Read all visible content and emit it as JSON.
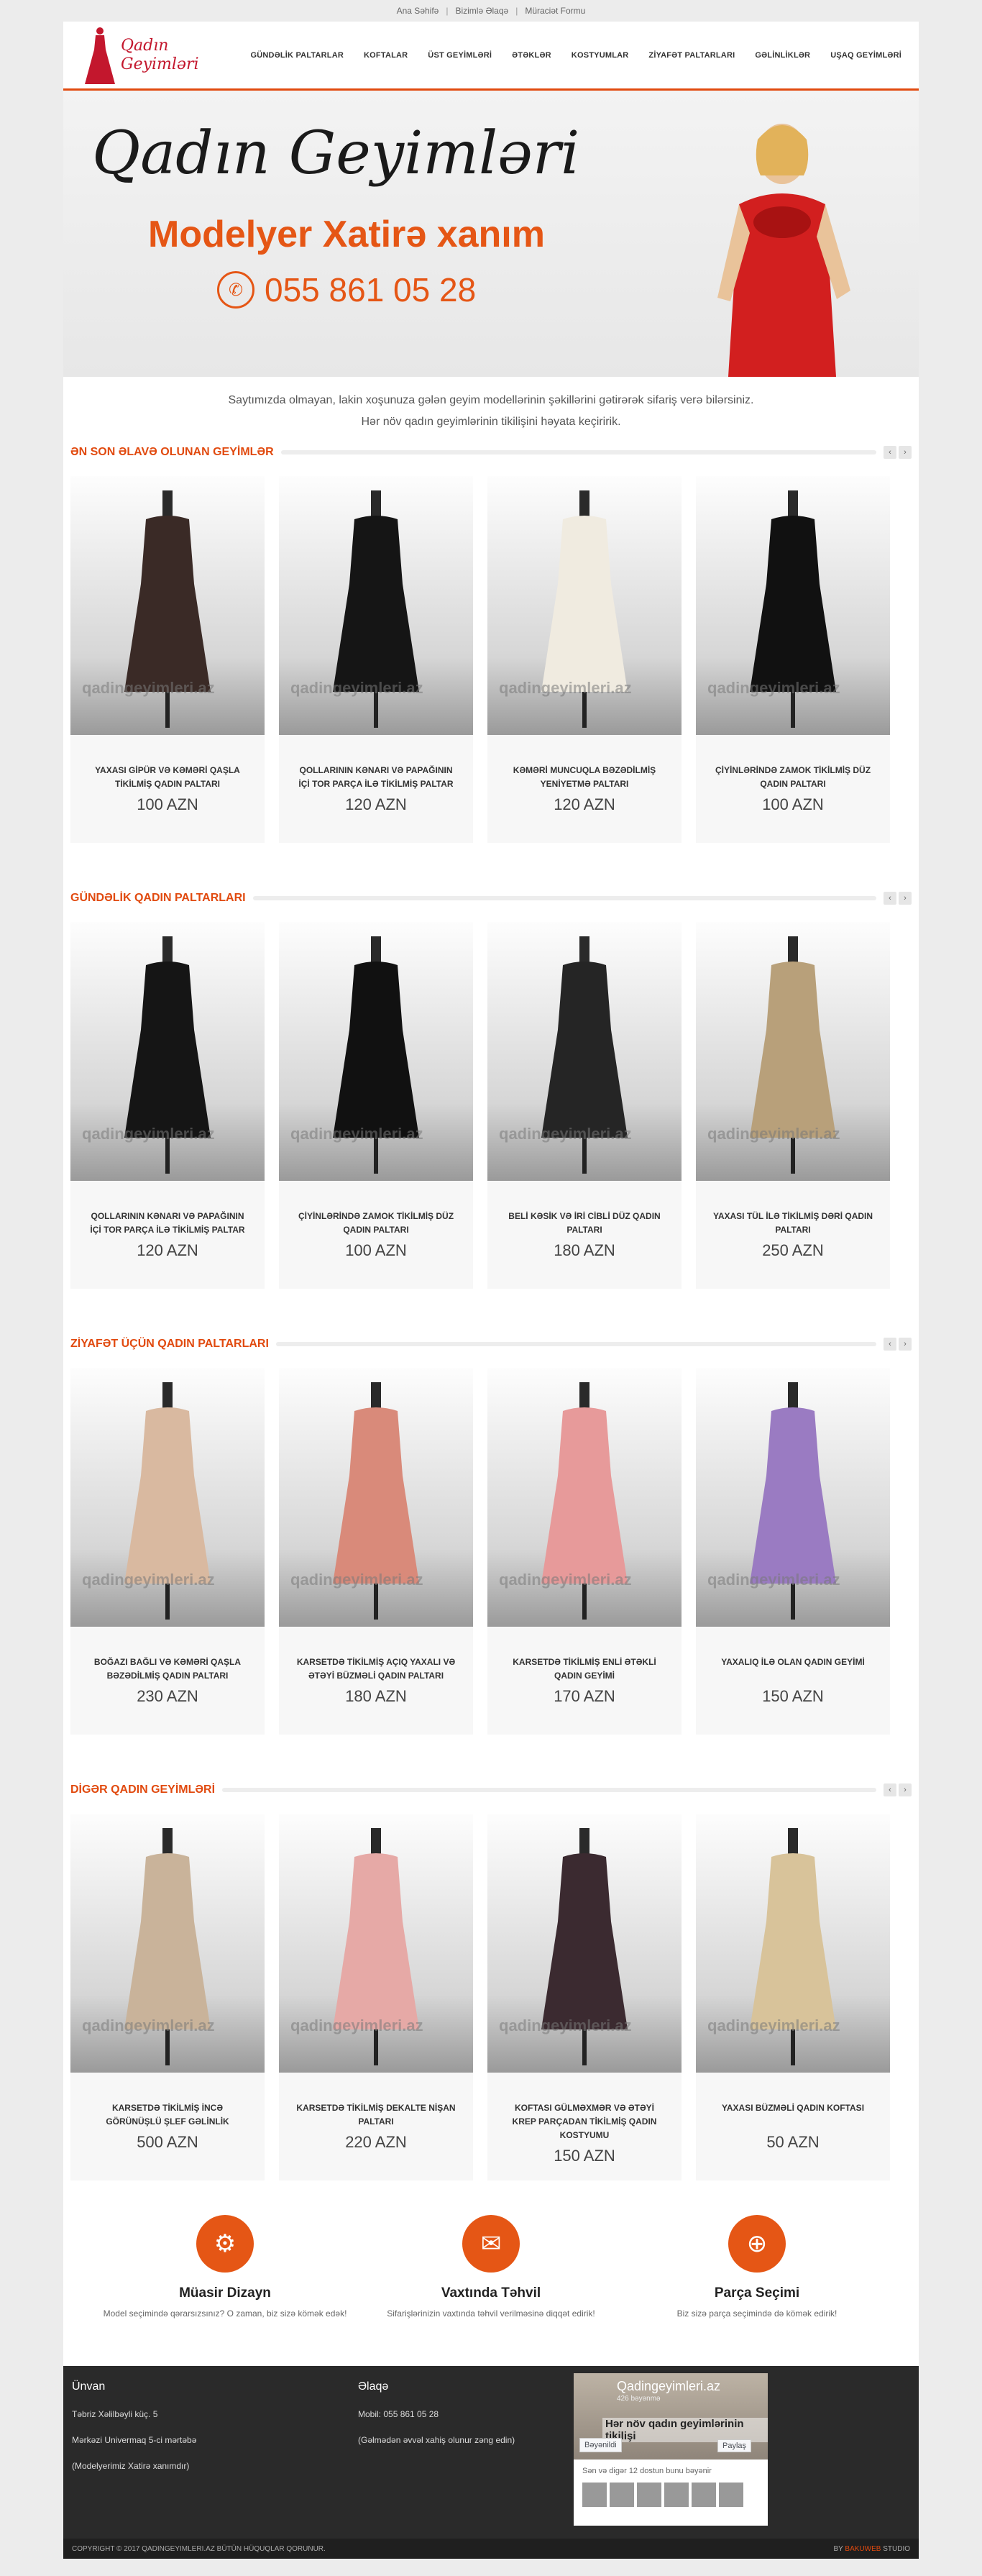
{
  "topbar": {
    "links": [
      "Ana Səhifə",
      "Bizimlə Əlaqə",
      "Müraciət Formu"
    ],
    "sep": "|"
  },
  "logo": {
    "line1": "Qadın",
    "line2": "Geyimləri"
  },
  "nav": [
    "GÜNDƏLİK PALTARLAR",
    "KOFTALAR",
    "ÜST GEYİMLƏRİ",
    "ƏTƏKLƏR",
    "KOSTYUMLAR",
    "ZİYAFƏT PALTARLARI",
    "GƏLİNLİKLƏR",
    "UŞAQ GEYİMLƏRİ"
  ],
  "banner": {
    "script": "Qadın Geyimləri",
    "model": "Modelyer Xatirə xanım",
    "phone": "055 861 05 28"
  },
  "intro": {
    "line1": "Saytımızda olmayan, lakin xoşunuza gələn geyim modellərinin şəkillərini gətirərək sifariş verə bilərsiniz.",
    "line2": "Hər növ qadın geyimlərinin tikilişini həyata keçiririk."
  },
  "watermark": "qadingeyimleri.az",
  "sections": [
    {
      "title": "ƏN SON ƏLAVƏ OLUNAN GEYİMLƏR",
      "items": [
        {
          "name": "YAXASI GİPÜR VƏ KƏMƏRİ QAŞLA TİKİLMİŞ QADIN PALTARI",
          "price": "100 AZN",
          "color": "#3a2a26"
        },
        {
          "name": "QOLLARININ KƏNARI VƏ PAPAĞININ İÇİ TOR PARÇA İLƏ TİKİLMİŞ PALTAR",
          "price": "120 AZN",
          "color": "#151515"
        },
        {
          "name": "KƏMƏRİ MUNCUQLA BƏZƏDİLMİŞ YENİYETMƏ PALTARI",
          "price": "120 AZN",
          "color": "#f0ebe0"
        },
        {
          "name": "ÇİYİNLƏRİNDƏ ZAMOK TİKİLMİŞ DÜZ QADIN PALTARI",
          "price": "100 AZN",
          "color": "#111111"
        }
      ]
    },
    {
      "title": "GÜNDƏLİK QADIN PALTARLARI",
      "items": [
        {
          "name": "QOLLARININ KƏNARI VƏ PAPAĞININ İÇİ TOR PARÇA İLƏ TİKİLMİŞ PALTAR",
          "price": "120 AZN",
          "color": "#151515"
        },
        {
          "name": "ÇİYİNLƏRİNDƏ ZAMOK TİKİLMİŞ DÜZ QADIN PALTARI",
          "price": "100 AZN",
          "color": "#111111"
        },
        {
          "name": "BELİ KƏSİK VƏ İRİ CİBLİ DÜZ QADIN PALTARI",
          "price": "180 AZN",
          "color": "#252525"
        },
        {
          "name": "YAXASI TÜL İLƏ TİKİLMİŞ DƏRİ QADIN PALTARI",
          "price": "250 AZN",
          "color": "#b8a07a"
        }
      ]
    },
    {
      "title": "ZİYAFƏT ÜÇÜN QADIN PALTARLARI",
      "items": [
        {
          "name": "BOĞAZI BAĞLI VƏ KƏMƏRİ QAŞLA BƏZƏDİLMİŞ QADIN PALTARI",
          "price": "230 AZN",
          "color": "#d9b9a0"
        },
        {
          "name": "KARSETDƏ TİKİLMİŞ AÇIQ YAXALI VƏ ƏTƏYİ BÜZMƏLİ QADIN PALTARI",
          "price": "180 AZN",
          "color": "#d98a7a"
        },
        {
          "name": "KARSETDƏ TİKİLMİŞ ENLİ ƏTƏKLİ QADIN GEYİMİ",
          "price": "170 AZN",
          "color": "#e79a9a"
        },
        {
          "name": "YAXALIQ İLƏ OLAN QADIN GEYİMİ",
          "price": "150 AZN",
          "color": "#9a7bc2"
        }
      ]
    },
    {
      "title": "DİGƏR QADIN GEYİMLƏRİ",
      "items": [
        {
          "name": "KARSETDƏ TİKİLMİŞ İNCƏ GÖRÜNÜŞLÜ ŞLEF GƏLİNLİK",
          "price": "500 AZN",
          "color": "#c9b39a"
        },
        {
          "name": "KARSETDƏ TİKİLMİŞ DEKALTE NİŞAN PALTARI",
          "price": "220 AZN",
          "color": "#e6a9a6"
        },
        {
          "name": "KOFTASI GÜLMƏXMƏR VƏ ƏTƏYİ KREP PARÇADAN TİKİLMİŞ QADIN KOSTYUMU",
          "price": "150 AZN",
          "color": "#3b2a30"
        },
        {
          "name": "YAXASI BÜZMƏLİ QADIN KOFTASI",
          "price": "50 AZN",
          "color": "#d8c39a"
        }
      ]
    }
  ],
  "features": [
    {
      "icon": "gear-icon",
      "glyph": "⚙",
      "title": "Müasir Dizayn",
      "text": "Model seçimində qərarsızsınız? O zaman, biz sizə kömək edək!"
    },
    {
      "icon": "bag-icon",
      "glyph": "✉",
      "title": "Vaxtında Təhvil",
      "text": "Sifarişlərinizin vaxtında təhvil verilməsinə diqqət edirik!"
    },
    {
      "icon": "globe-icon",
      "glyph": "⊕",
      "title": "Parça Seçimi",
      "text": "Biz sizə parça seçimində də kömək edirik!"
    }
  ],
  "footer": {
    "address_title": "Ünvan",
    "address": [
      "Təbriz Xəlilbəyli küç. 5",
      "Mərkəzi Univermaq 5-ci mərtəbə",
      "(Modelyerimiz Xatirə xanımdır)"
    ],
    "contact_title": "Əlaqə",
    "contact": [
      "Mobil: 055 861 05 28",
      "(Gəlmədən əvvəl xahiş olunur zəng edin)"
    ],
    "fb": {
      "name": "Qadingeyimleri.az",
      "likes": "426 bəyənmə",
      "headline": "Hər növ qadın geyimlərinin tikilişi",
      "like": "Bəyənildi",
      "share": "Paylaş",
      "friends": "Sən və digər 12 dostun bunu bəyənir"
    }
  },
  "copyright": {
    "left": "COPYRIGHT © 2017 QADINGEYIMLERI.AZ BÜTÜN HÜQUQLAR QORUNUR.",
    "by": "BY",
    "studio_brand": "BAKUWEB",
    "studio": "STUDIO"
  },
  "colors": {
    "accent": "#e14a0f",
    "dark": "#2a2a2a"
  }
}
